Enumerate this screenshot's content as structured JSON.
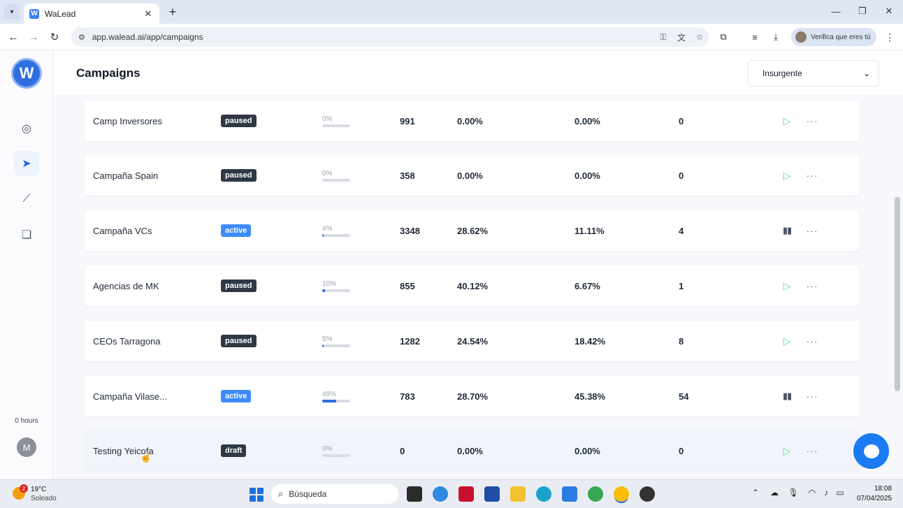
{
  "browser": {
    "tab_title": "WaLead",
    "url": "app.walead.ai/app/campaigns",
    "profile_label": "Verifica que eres tú"
  },
  "app": {
    "page_title": "Campaigns",
    "workspace_select": "Insurgente",
    "hours_label": "0 hours",
    "user_initial": "M",
    "logo_letter": "W"
  },
  "campaigns": [
    {
      "name": "Camp Inversores",
      "status": "paused",
      "progress_label": "0%",
      "progress": 0,
      "leads": "991",
      "rate1": "0.00%",
      "rate2": "0.00%",
      "count": "0",
      "action": "play"
    },
    {
      "name": "Campaña Spain",
      "status": "paused",
      "progress_label": "0%",
      "progress": 0,
      "leads": "358",
      "rate1": "0.00%",
      "rate2": "0.00%",
      "count": "0",
      "action": "play"
    },
    {
      "name": "Campaña VCs",
      "status": "active",
      "progress_label": "4%",
      "progress": 4,
      "leads": "3348",
      "rate1": "28.62%",
      "rate2": "11.11%",
      "count": "4",
      "action": "pause"
    },
    {
      "name": "Agencias de MK",
      "status": "paused",
      "progress_label": "10%",
      "progress": 10,
      "leads": "855",
      "rate1": "40.12%",
      "rate2": "6.67%",
      "count": "1",
      "action": "play"
    },
    {
      "name": "CEOs Tarragona",
      "status": "paused",
      "progress_label": "5%",
      "progress": 5,
      "leads": "1282",
      "rate1": "24.54%",
      "rate2": "18.42%",
      "count": "8",
      "action": "play"
    },
    {
      "name": "Campaña Vilase...",
      "status": "active",
      "progress_label": "49%",
      "progress": 49,
      "leads": "783",
      "rate1": "28.70%",
      "rate2": "45.38%",
      "count": "54",
      "action": "pause"
    },
    {
      "name": "Testing Yeicofa",
      "status": "draft",
      "progress_label": "0%",
      "progress": 0,
      "leads": "0",
      "rate1": "0.00%",
      "rate2": "0.00%",
      "count": "0",
      "action": "play"
    }
  ],
  "taskbar": {
    "weather_temp": "19°C",
    "weather_desc": "Soleado",
    "weather_badge": "2",
    "search_placeholder": "Búsqueda",
    "time": "18:08",
    "date": "07/04/2025"
  },
  "icons": {
    "play": "▷",
    "pause": "▮▮",
    "more": "···"
  },
  "colors": {
    "accent": "#3d8bff",
    "paused_badge": "#2f3845",
    "play_icon": "#4ade80",
    "chat_button": "#1a7bf2"
  }
}
